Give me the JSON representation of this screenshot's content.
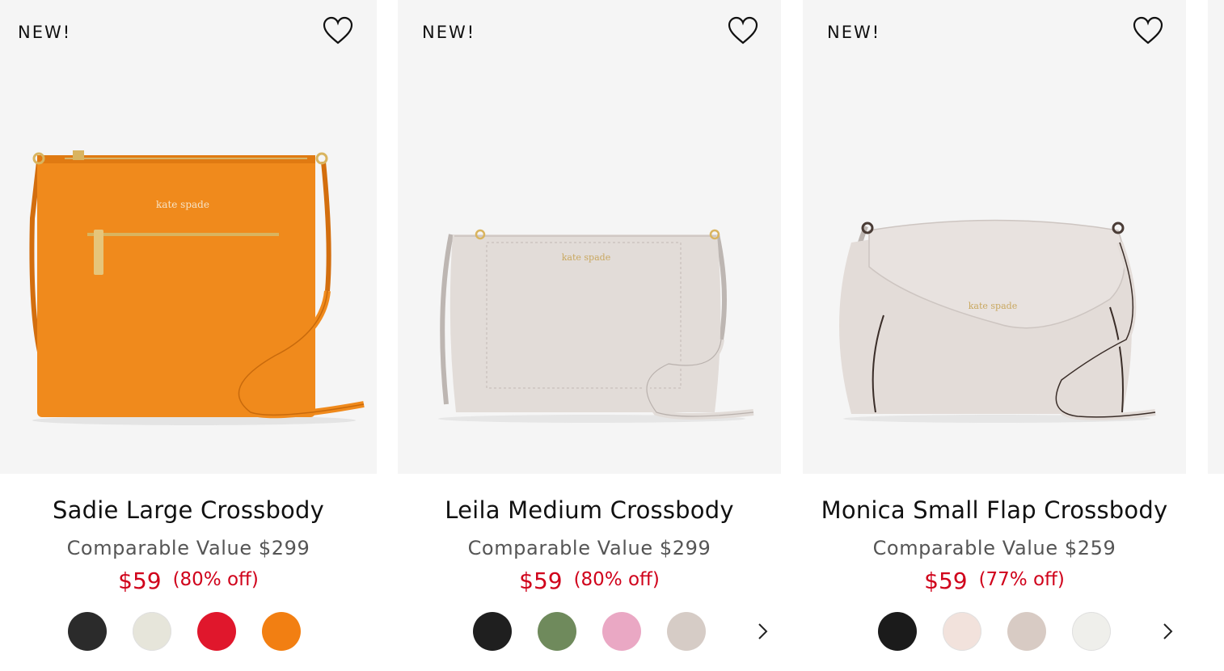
{
  "products": [
    {
      "badge": "NEW!",
      "name": "Sadie Large Crossbody",
      "comparable_value": "Comparable Value $299",
      "price": "$59",
      "discount": "(80% off)",
      "swatches": [
        {
          "name": "black",
          "color": "#2b2b2b"
        },
        {
          "name": "cream",
          "color": "#e6e5da"
        },
        {
          "name": "red",
          "color": "#e0172c"
        },
        {
          "name": "orange",
          "color": "#f27f12"
        }
      ],
      "has_next": false,
      "bag_color": "#f08a1c"
    },
    {
      "badge": "NEW!",
      "name": "Leila Medium Crossbody",
      "comparable_value": "Comparable Value $299",
      "price": "$59",
      "discount": "(80% off)",
      "swatches": [
        {
          "name": "black",
          "color": "#1f1f1f"
        },
        {
          "name": "green",
          "color": "#6f8a5c"
        },
        {
          "name": "pink",
          "color": "#eaa8c4"
        },
        {
          "name": "taupe",
          "color": "#d6ccc6"
        }
      ],
      "has_next": true,
      "bag_color": "#e2dcd8"
    },
    {
      "badge": "NEW!",
      "name": "Monica Small Flap Crossbody",
      "comparable_value": "Comparable Value $259",
      "price": "$59",
      "discount": "(77% off)",
      "swatches": [
        {
          "name": "black",
          "color": "#1b1b1b"
        },
        {
          "name": "blush",
          "color": "#f2e2dc"
        },
        {
          "name": "taupe",
          "color": "#d8cbc4"
        },
        {
          "name": "white",
          "color": "#efefeb"
        }
      ],
      "has_next": true,
      "bag_color": "#e3dcd8"
    }
  ],
  "colors": {
    "sale_red": "#d0021b",
    "image_bg": "#f5f5f5"
  }
}
